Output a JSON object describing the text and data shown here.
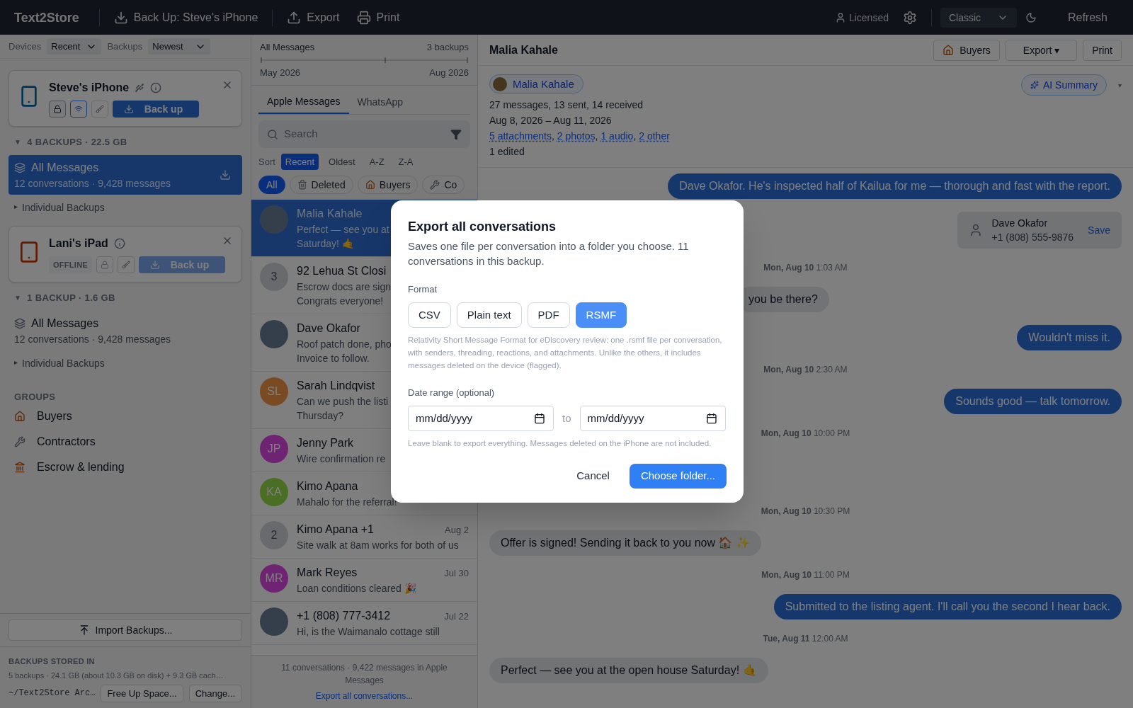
{
  "topbar": {
    "brand": "Text2Store",
    "actions": [
      {
        "kind": "backup",
        "label": "Back Up: Steve's iPhone"
      },
      {
        "kind": "export",
        "label": "Export"
      },
      {
        "kind": "print",
        "label": "Print"
      }
    ],
    "license": "Licensed",
    "theme": "Classic",
    "refresh": "Refresh"
  },
  "sidebar": {
    "devices_label": "Devices",
    "devices_value": "Recent",
    "backups_label": "Backups",
    "backups_value": "Newest",
    "devices": [
      {
        "kind": "phone",
        "name": "Steve's iPhone",
        "usb": true,
        "wifi": true,
        "offline": false,
        "backup_label": "Back up",
        "backup_disabled": false,
        "caret": "▼",
        "section": "4 BACKUPS · 22.5 GB",
        "expanded": true,
        "backup": {
          "title": "All Messages",
          "subtitle": "12 conversations · 9,428 messages",
          "selected": true
        },
        "individual_caret": "▸",
        "individual": "Individual Backups"
      },
      {
        "kind": "tablet",
        "name": "Lani's iPad",
        "usb": false,
        "wifi": false,
        "offline": true,
        "status_label": "OFFLINE",
        "backup_label": "Back up",
        "backup_disabled": true,
        "caret": "▼",
        "section": "1 BACKUP · 1.6 GB",
        "expanded": true,
        "backup": {
          "title": "All Messages",
          "subtitle": "12 conversations · 9,428 messages",
          "selected": false
        },
        "individual_caret": "▸",
        "individual": "Individual Backups"
      }
    ],
    "groups_title": "GROUPS",
    "groups": [
      {
        "kind": "house",
        "label": "Buyers"
      },
      {
        "kind": "wrench",
        "label": "Contractors"
      },
      {
        "kind": "bank",
        "label": "Escrow & lending"
      }
    ],
    "import": "Import Backups...",
    "storage_title": "BACKUPS STORED IN",
    "storage_info": "5 backups · 24.1 GB (about 10.3 GB on disk) + 9.3 GB cach…",
    "storage_path": "~/Text2Store Arc…",
    "free_up": "Free Up Space...",
    "change": "Change..."
  },
  "list": {
    "timeline": {
      "title": "All Messages",
      "count": "3 backups",
      "start": "May 2026",
      "end": "Aug 2026"
    },
    "tabs": [
      {
        "label": "Apple Messages",
        "selected": true
      },
      {
        "label": "WhatsApp",
        "selected": false
      }
    ],
    "search_placeholder": "Search",
    "sort_label": "Sort",
    "sorts": [
      {
        "label": "Recent",
        "selected": true
      },
      {
        "label": "Oldest",
        "selected": false
      },
      {
        "label": "A-Z",
        "selected": false
      },
      {
        "label": "Z-A",
        "selected": false
      }
    ],
    "filters": [
      {
        "kind": "none",
        "label": "All",
        "selected": true
      },
      {
        "kind": "trash",
        "label": "Deleted",
        "selected": false
      },
      {
        "kind": "house",
        "label": "Buyers",
        "selected": false
      },
      {
        "kind": "wrench",
        "label": "Co",
        "selected": false
      }
    ],
    "conversations": [
      {
        "kind": "photo",
        "name": "Malia Kahale",
        "preview": "Perfect — see you at\nSaturday! 🤙",
        "selected": true
      },
      {
        "kind": "count",
        "initials": "3",
        "name": "92 Lehua St Closi",
        "preview": "Escrow docs are sign\nCongrats everyone!",
        "selected": false
      },
      {
        "kind": "photo",
        "name": "Dave Okafor",
        "preview": "Roof patch done, pho\nInvoice to follow.",
        "selected": false
      },
      {
        "kind": "initials",
        "initials": "SL",
        "color": "#7a4a22",
        "name": "Sarah Lindqvist",
        "preview": "Can we push the listi\nThursday?",
        "selected": false
      },
      {
        "kind": "initials",
        "initials": "JP",
        "color": "#6e2472",
        "name": "Jenny Park",
        "preview": "Wire confirmation re",
        "selected": false
      },
      {
        "kind": "initials",
        "initials": "KA",
        "color": "#4a6e24",
        "name": "Kimo Apana",
        "preview": "Mahalo for the referral!",
        "selected": false
      },
      {
        "kind": "count",
        "initials": "2",
        "name": "Kimo Apana +1",
        "date": "Aug 2",
        "preview": "Site walk at 8am works for both of us",
        "selected": false
      },
      {
        "kind": "initials",
        "initials": "MR",
        "color": "#6e2472",
        "name": "Mark Reyes",
        "date": "Jul 30",
        "preview": "Loan conditions cleared 🎉",
        "selected": false
      },
      {
        "kind": "photo",
        "name": "+1 (808) 777-3412",
        "date": "Jul 22",
        "preview": "Hi, is the Waimanalo cottage still",
        "selected": false
      }
    ],
    "footer": "11 conversations · 9,422 messages in Apple Messages",
    "export_all": "Export all conversations..."
  },
  "chat": {
    "title": "Malia Kahale",
    "buttons": [
      {
        "kind": "house",
        "label": "Buyers"
      },
      {
        "kind": "menu",
        "label": "Export ▾"
      },
      {
        "kind": "plain",
        "label": "Print"
      }
    ],
    "contact": "Malia Kahale",
    "stats": "27 messages, 13 sent, 14 received",
    "range": "Aug 8, 2026 – Aug 11, 2026",
    "links": [
      {
        "label": "5 attachments",
        "sep": ","
      },
      {
        "label": "2 photos",
        "sep": ","
      },
      {
        "label": "1 audio",
        "sep": ","
      },
      {
        "label": "2 other"
      }
    ],
    "edited": "1 edited",
    "ai_summary": "AI Summary",
    "ai_caret": "▾",
    "messages": [
      {
        "kind": "sent",
        "text": "Dave Okafor. He's inspected half of Kailua for me — thorough and fast with the report."
      },
      {
        "kind": "contact",
        "name": "Dave Okafor",
        "phone": "+1 (808) 555-9876",
        "action": "Save"
      },
      {
        "kind": "time",
        "text": "**Mon, Aug 10** 1:03 AM"
      },
      {
        "kind": "received_partial",
        "text": "you be there?"
      },
      {
        "kind": "sent",
        "text": "Wouldn't miss it."
      },
      {
        "kind": "time",
        "text": "**Mon, Aug 10** 2:30 AM"
      },
      {
        "kind": "sent",
        "text": "Sounds good — talk tomorrow."
      },
      {
        "kind": "time",
        "text": "**Mon, Aug 10** 10:00 PM"
      },
      {
        "kind": "gap"
      },
      {
        "kind": "time",
        "text": "**Mon, Aug 10** 10:30 PM"
      },
      {
        "kind": "received",
        "text": "Offer is signed! Sending it back to you now 🏠 ✨"
      },
      {
        "kind": "time",
        "text": "**Mon, Aug 10** 11:00 PM"
      },
      {
        "kind": "sent",
        "text": "Submitted to the listing agent. I'll call you the second I hear back."
      },
      {
        "kind": "time",
        "text": "**Tue, Aug 11** 12:00 AM"
      },
      {
        "kind": "received",
        "text": "Perfect — see you at the open house Saturday! 🤙"
      }
    ]
  },
  "dialog": {
    "title": "Export all conversations",
    "description": "Saves one file per conversation into a folder you choose. 11 conversations in this backup.",
    "format_label": "Format",
    "formats": [
      {
        "label": "CSV",
        "selected": false
      },
      {
        "label": "Plain text",
        "selected": false
      },
      {
        "label": "PDF",
        "selected": false
      },
      {
        "label": "RSMF",
        "selected": true
      }
    ],
    "format_note": "Relativity Short Message Format for eDiscovery review: one .rsmf file per conversation, with senders, threading, reactions, and attachments. Unlike the others, it includes messages deleted on the device (flagged).",
    "date_label": "Date range (optional)",
    "from_placeholder": "mm/dd/yyyy",
    "to_label": "to",
    "to_placeholder": "mm/dd/yyyy",
    "hint": "Leave blank to export everything. Messages deleted on the iPhone are not included.",
    "cancel": "Cancel",
    "confirm": "Choose folder..."
  }
}
